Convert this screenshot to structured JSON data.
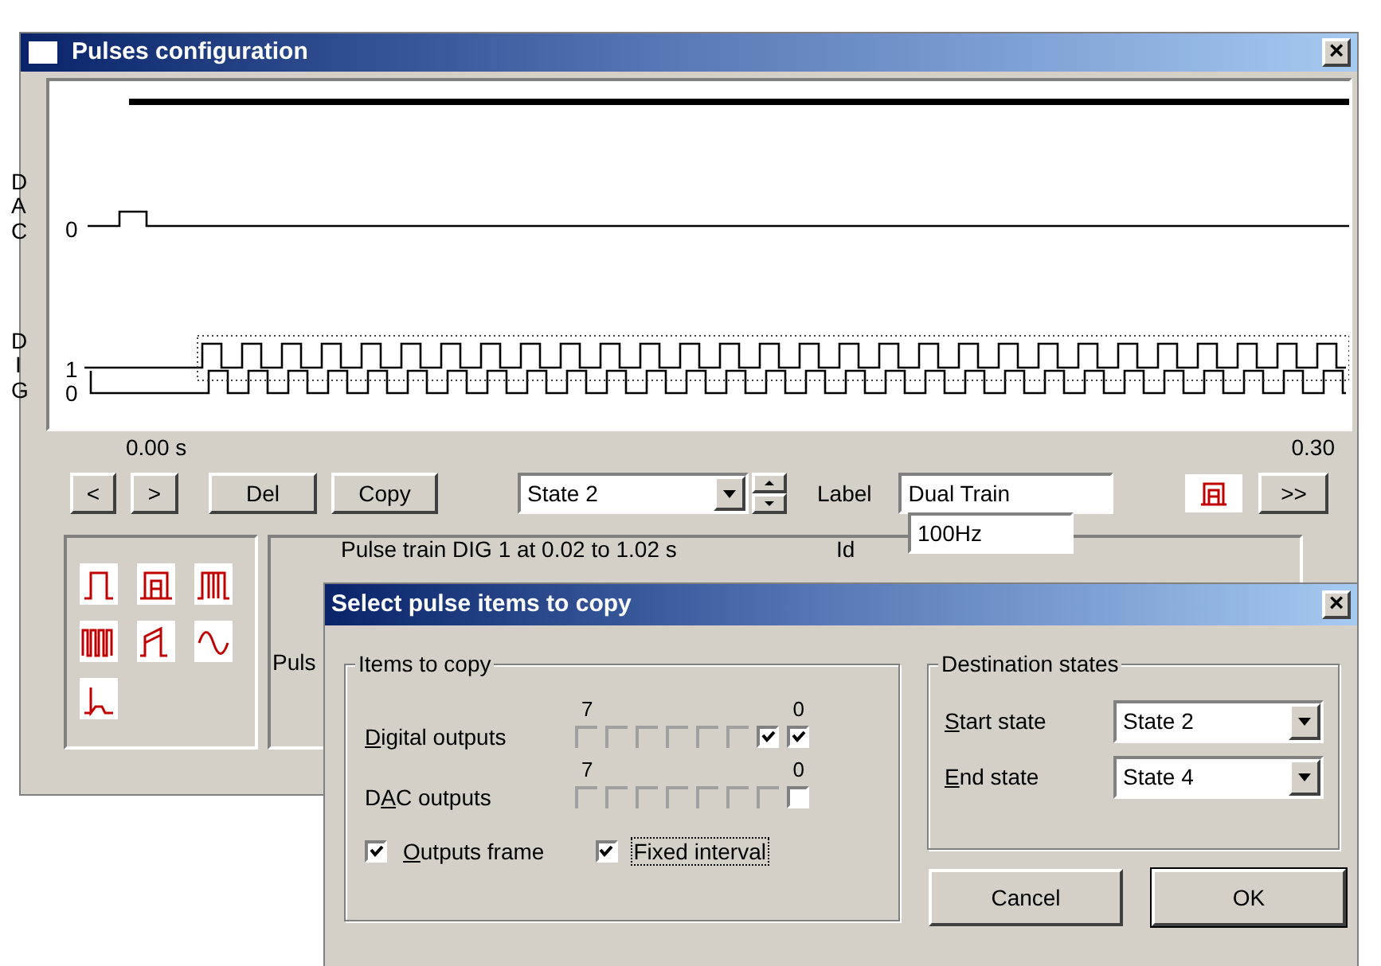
{
  "main_window": {
    "title": "Pulses configuration",
    "close": "×",
    "plot": {
      "dac_label": "DAC",
      "dac_channel": "0",
      "dig_label": "DIG",
      "dig_channels": [
        "1",
        "0"
      ],
      "time_start": "0.00 s",
      "time_end": "0.30"
    },
    "toolbar": {
      "prev": "<",
      "next": ">",
      "delete": "Del",
      "copy": "Copy",
      "state": "State 2",
      "label_caption": "Label",
      "label_value": "Dual Train",
      "forward": ">>"
    },
    "details": {
      "description": "Pulse train DIG 1 at 0.02 to 1.02 s",
      "id_caption": "Id",
      "id_value": "100Hz",
      "partial_label": "Puls"
    }
  },
  "dialog": {
    "title": "Select pulse items to copy",
    "close": "×",
    "items_group": {
      "title": "Items to copy",
      "rows": [
        {
          "label_parts": {
            "accel": "D",
            "rest": "igital outputs"
          },
          "high": "7",
          "low": "0",
          "boxes": [
            {
              "checked": false,
              "disabled": true
            },
            {
              "checked": false,
              "disabled": true
            },
            {
              "checked": false,
              "disabled": true
            },
            {
              "checked": false,
              "disabled": true
            },
            {
              "checked": false,
              "disabled": true
            },
            {
              "checked": false,
              "disabled": true
            },
            {
              "checked": true,
              "disabled": false
            },
            {
              "checked": true,
              "disabled": false
            }
          ]
        },
        {
          "label_parts": {
            "lead": "D",
            "accel": "A",
            "rest": "C outputs"
          },
          "high": "7",
          "low": "0",
          "boxes": [
            {
              "checked": false,
              "disabled": true
            },
            {
              "checked": false,
              "disabled": true
            },
            {
              "checked": false,
              "disabled": true
            },
            {
              "checked": false,
              "disabled": true
            },
            {
              "checked": false,
              "disabled": true
            },
            {
              "checked": false,
              "disabled": true
            },
            {
              "checked": false,
              "disabled": true
            },
            {
              "checked": false,
              "disabled": false
            }
          ]
        }
      ],
      "options": [
        {
          "label_parts": {
            "accel": "O",
            "rest": "utputs frame"
          },
          "checked": true,
          "focused": false
        },
        {
          "label_parts": {
            "rest": "Fixed interval"
          },
          "checked": true,
          "focused": true
        }
      ]
    },
    "dest_group": {
      "title": "Destination states",
      "start_label_parts": {
        "accel": "S",
        "rest": "tart state"
      },
      "start_value": "State 2",
      "end_label_parts": {
        "accel": "E",
        "rest": "nd state"
      },
      "end_value": "State 4"
    },
    "buttons": [
      "Cancel",
      "OK"
    ]
  }
}
